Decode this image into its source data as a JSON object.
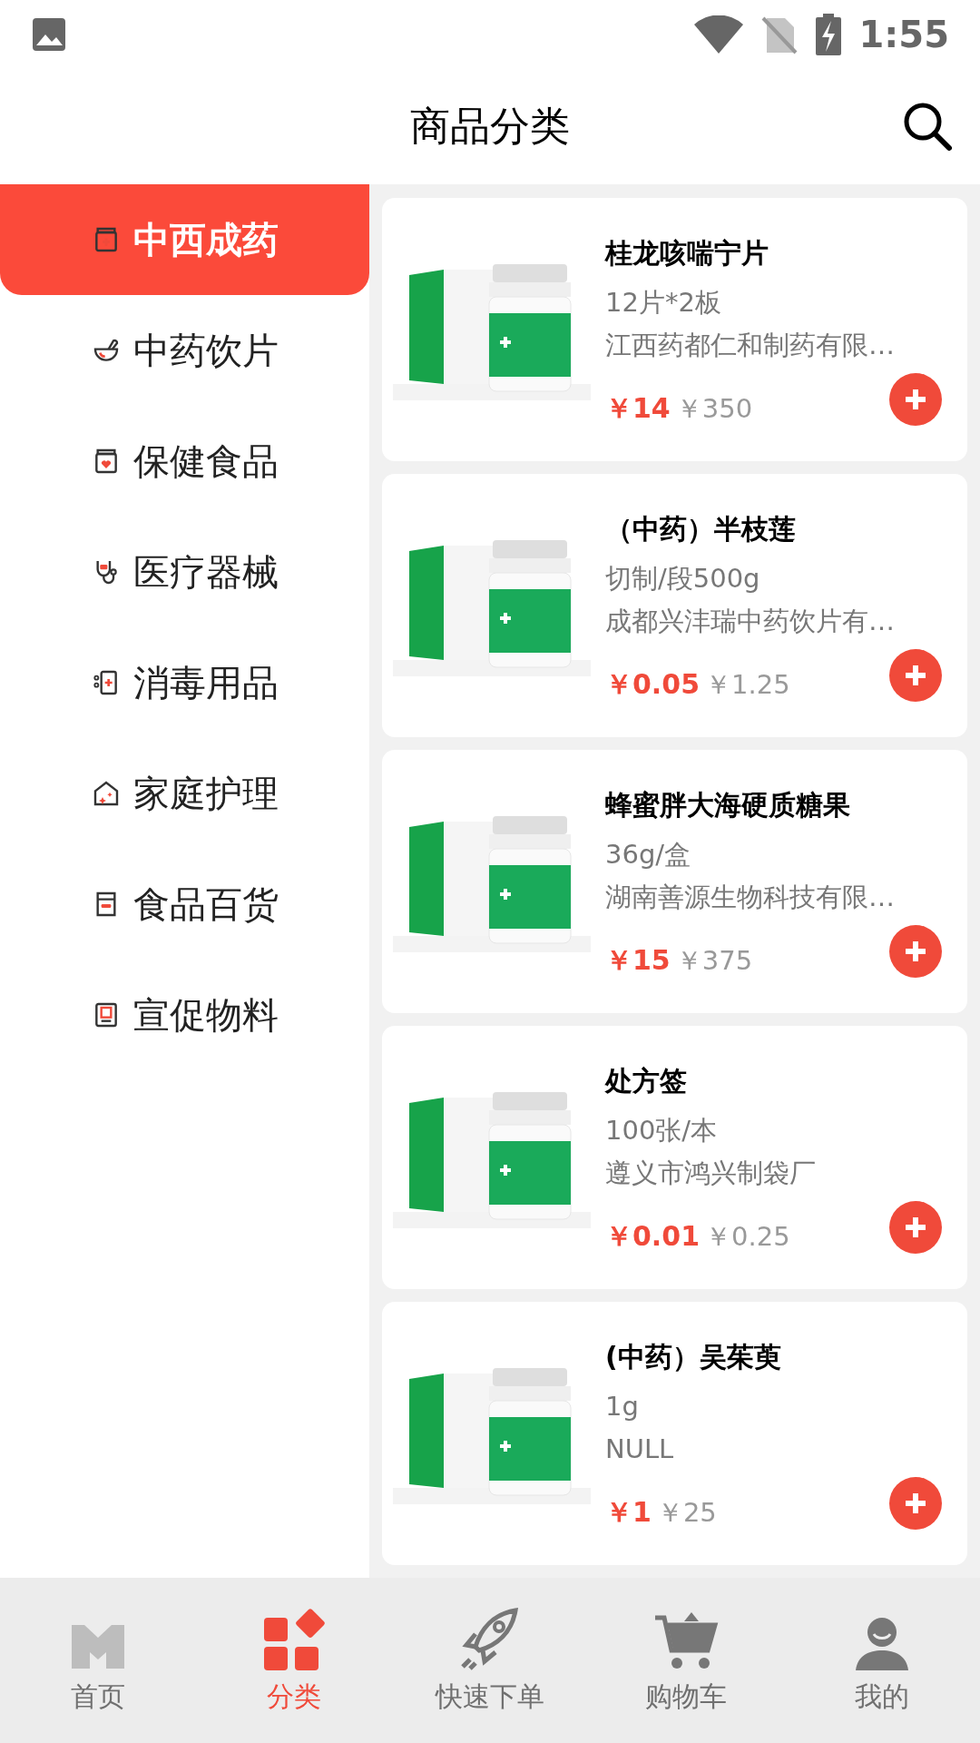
{
  "status_bar": {
    "time": "1:55"
  },
  "header": {
    "title": "商品分类"
  },
  "categories": [
    {
      "label": "中西成药",
      "selected": true
    },
    {
      "label": "中药饮片",
      "selected": false
    },
    {
      "label": "保健食品",
      "selected": false
    },
    {
      "label": "医疗器械",
      "selected": false
    },
    {
      "label": "消毒用品",
      "selected": false
    },
    {
      "label": "家庭护理",
      "selected": false
    },
    {
      "label": "食品百货",
      "selected": false
    },
    {
      "label": "宣促物料",
      "selected": false
    }
  ],
  "products": [
    {
      "name": "桂龙咳喘宁片",
      "spec": "12片*2板",
      "maker": "江西药都仁和制药有限…",
      "price": "￥14",
      "list_price": "￥350"
    },
    {
      "name": "（中药）半枝莲",
      "spec": "切制/段500g",
      "maker": "成都兴沣瑞中药饮片有…",
      "price": "￥0.05",
      "list_price": "￥1.25"
    },
    {
      "name": "蜂蜜胖大海硬质糖果",
      "spec": "36g/盒",
      "maker": "湖南善源生物科技有限…",
      "price": "￥15",
      "list_price": "￥375"
    },
    {
      "name": "处方签",
      "spec": "100张/本",
      "maker": "遵义市鸿兴制袋厂",
      "price": "￥0.01",
      "list_price": "￥0.25"
    },
    {
      "name": "(中药）吴茱萸",
      "spec": "1g",
      "maker": "NULL",
      "price": "￥1",
      "list_price": "￥25"
    }
  ],
  "tab_bar": [
    {
      "label": "首页",
      "selected": false
    },
    {
      "label": "分类",
      "selected": true
    },
    {
      "label": "快速下单",
      "selected": false
    },
    {
      "label": "购物车",
      "selected": false
    },
    {
      "label": "我的",
      "selected": false
    }
  ]
}
